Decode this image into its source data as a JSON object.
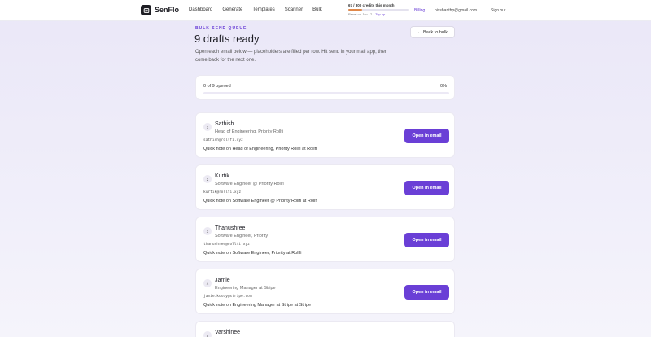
{
  "nav": {
    "brand": "SenFlo",
    "links": [
      "Dashboard",
      "Generate",
      "Templates",
      "Scanner",
      "Bulk"
    ],
    "credits_text": "67 / 300 credits this month",
    "credits_fraction": 0.223,
    "reset_text": "Reset on Jan 17",
    "topup_label": "Top up",
    "billing_label": "Billing",
    "user_email": "nisshanthp@gmail.com",
    "signout_label": "Sign out"
  },
  "header": {
    "eyebrow": "BULK SEND QUEUE",
    "title": "9 drafts ready",
    "description": "Open each email below — placeholders are filled per row. Hit send in your mail app, then come back for the next one.",
    "back_label": "← Back to bulk"
  },
  "progress": {
    "label": "0 of 9 opened",
    "percent_label": "0%",
    "fraction": 0
  },
  "drafts": [
    {
      "num": "1",
      "name": "Sathish",
      "role": "Head of Engineering, Priority Rollfi",
      "email": "sathish@rollfi.xyz",
      "note": "Quick note on Head of Engineering, Priority Rollfi at Rollfi",
      "button": "Open in email"
    },
    {
      "num": "2",
      "name": "Kurtik",
      "role": "Software Engineer @ Priority Rollfi",
      "email": "kurtik@rollfi.xyz",
      "note": "Quick note on Software Engineer @ Priority Rollfi at Rollfi",
      "button": "Open in email"
    },
    {
      "num": "3",
      "name": "Thanushree",
      "role": "Software Engineer, Priority",
      "email": "thanushree@rollfi.xyz",
      "note": "Quick note on Software Engineer, Priority at Rollfi",
      "button": "Open in email"
    },
    {
      "num": "4",
      "name": "Jamie",
      "role": "Engineering Manager at Stripe",
      "email": "jamie.kosoy@stripe.com",
      "note": "Quick note on Engineering Manager at Stripe at Stripe",
      "button": "Open in email"
    },
    {
      "num": "5",
      "name": "Varshinee",
      "role": "",
      "email": "",
      "note": "",
      "button": ""
    }
  ],
  "colors": {
    "accent": "#6a3fd6",
    "credit_bar": "#e0884a"
  }
}
